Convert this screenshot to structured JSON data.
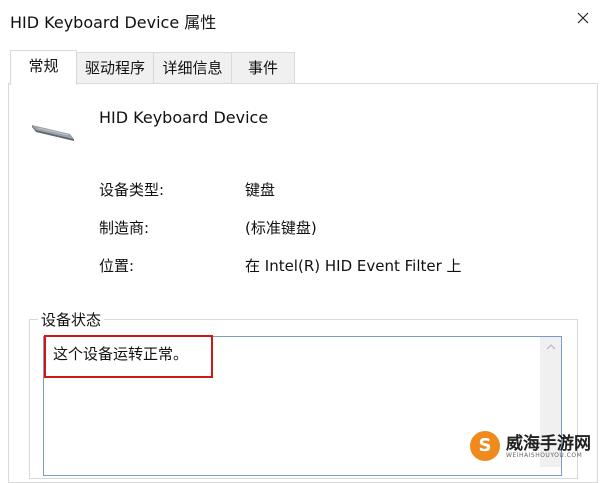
{
  "window": {
    "title": "HID Keyboard Device 属性"
  },
  "tabs": [
    {
      "label": "常规",
      "active": true
    },
    {
      "label": "驱动程序",
      "active": false
    },
    {
      "label": "详细信息",
      "active": false
    },
    {
      "label": "事件",
      "active": false
    }
  ],
  "device": {
    "name": "HID Keyboard Device",
    "icon": "keyboard-icon"
  },
  "properties": [
    {
      "label": "设备类型:",
      "value": "键盘"
    },
    {
      "label": "制造商:",
      "value": "(标准键盘)"
    },
    {
      "label": "位置:",
      "value": "在 Intel(R) HID Event Filter 上"
    }
  ],
  "status": {
    "group_title": "设备状态",
    "text": "这个设备运转正常。"
  },
  "watermark": {
    "logo": "S",
    "text": "威海手游网",
    "subtext": "WEIHAISHOUYOU.COM"
  },
  "colors": {
    "highlight": "#d01818",
    "input_border": "#7a9cc6",
    "watermark_logo": "#ee8a1e"
  }
}
